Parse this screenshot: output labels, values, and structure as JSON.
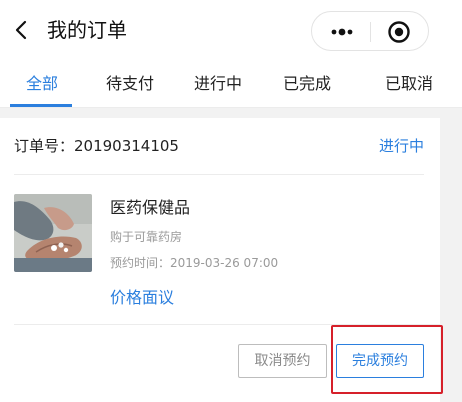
{
  "header": {
    "title": "我的订单",
    "back_icon": "chevron-left-icon",
    "more_icon": "more-dots-icon",
    "close_icon": "target-icon"
  },
  "tabs": [
    {
      "label": "全部",
      "active": true
    },
    {
      "label": "待支付",
      "active": false
    },
    {
      "label": "进行中",
      "active": false
    },
    {
      "label": "已完成",
      "active": false
    },
    {
      "label": "已取消",
      "active": false
    }
  ],
  "order": {
    "order_no": "订单号：20190314105",
    "status": "进行中",
    "product_name": "医药保健品",
    "pharmacy": "购于可靠药房",
    "appointment_time": "预约时间：2019-03-26 07:00",
    "negotiate_link": "价格面议",
    "cancel_button": "取消预约",
    "complete_button": "完成预约"
  },
  "colors": {
    "accent": "#2b7fde",
    "highlight": "#d6202a",
    "muted_text": "#9a9a9a",
    "background": "#f2f2f2"
  }
}
